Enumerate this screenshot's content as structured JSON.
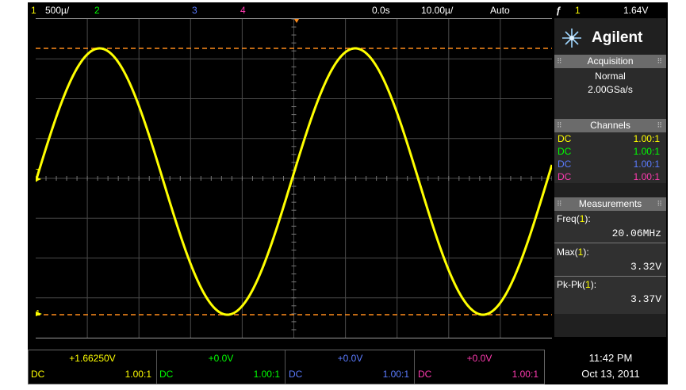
{
  "colors": {
    "ch1": "#ffff00",
    "ch2": "#00ff00",
    "ch3": "#5b7bff",
    "ch4": "#ff3ab0",
    "marker": "#ff8c1a",
    "grid": "#4a4a4a",
    "trace": "#ffff00"
  },
  "topbar": {
    "ch1_num": "1",
    "ch1_scale": "500µ/",
    "ch2_num": "2",
    "ch3_num": "3",
    "ch4_num": "4",
    "delay": "0.0s",
    "timebase": "10.00µ/",
    "trigger_mode": "Auto",
    "trigger_slope_icon": "rising-edge-icon",
    "trigger_source": "1",
    "trigger_level": "1.64V"
  },
  "sidebar": {
    "brand": "Agilent",
    "brand_icon": "spark-icon",
    "acquisition": {
      "title": "Acquisition",
      "mode": "Normal",
      "rate": "2.00GSa/s"
    },
    "channels": {
      "title": "Channels",
      "rows": [
        {
          "coupling": "DC",
          "probe": "1.00:1"
        },
        {
          "coupling": "DC",
          "probe": "1.00:1"
        },
        {
          "coupling": "DC",
          "probe": "1.00:1"
        },
        {
          "coupling": "DC",
          "probe": "1.00:1"
        }
      ]
    },
    "measurements": {
      "title": "Measurements",
      "items": [
        {
          "name": "Freq",
          "channel": "1",
          "value": "20.06MHz"
        },
        {
          "name": "Max",
          "channel": "1",
          "value": "3.32V"
        },
        {
          "name": "Pk-Pk",
          "channel": "1",
          "value": "3.37V"
        }
      ]
    }
  },
  "screen": {
    "trigger_marker_label": "T",
    "ground_marker_label": "1",
    "waveform": {
      "cycles_shown": 2,
      "phase_at_left": "zero-crossing-rising"
    }
  },
  "bottom": {
    "channels": [
      {
        "offset": "+1.66250V",
        "coupling": "DC",
        "probe": "1.00:1"
      },
      {
        "offset": "+0.0V",
        "coupling": "DC",
        "probe": "1.00:1"
      },
      {
        "offset": "+0.0V",
        "coupling": "DC",
        "probe": "1.00:1"
      },
      {
        "offset": "+0.0V",
        "coupling": "DC",
        "probe": "1.00:1"
      }
    ],
    "time": "11:42 PM",
    "date": "Oct 13, 2011"
  }
}
